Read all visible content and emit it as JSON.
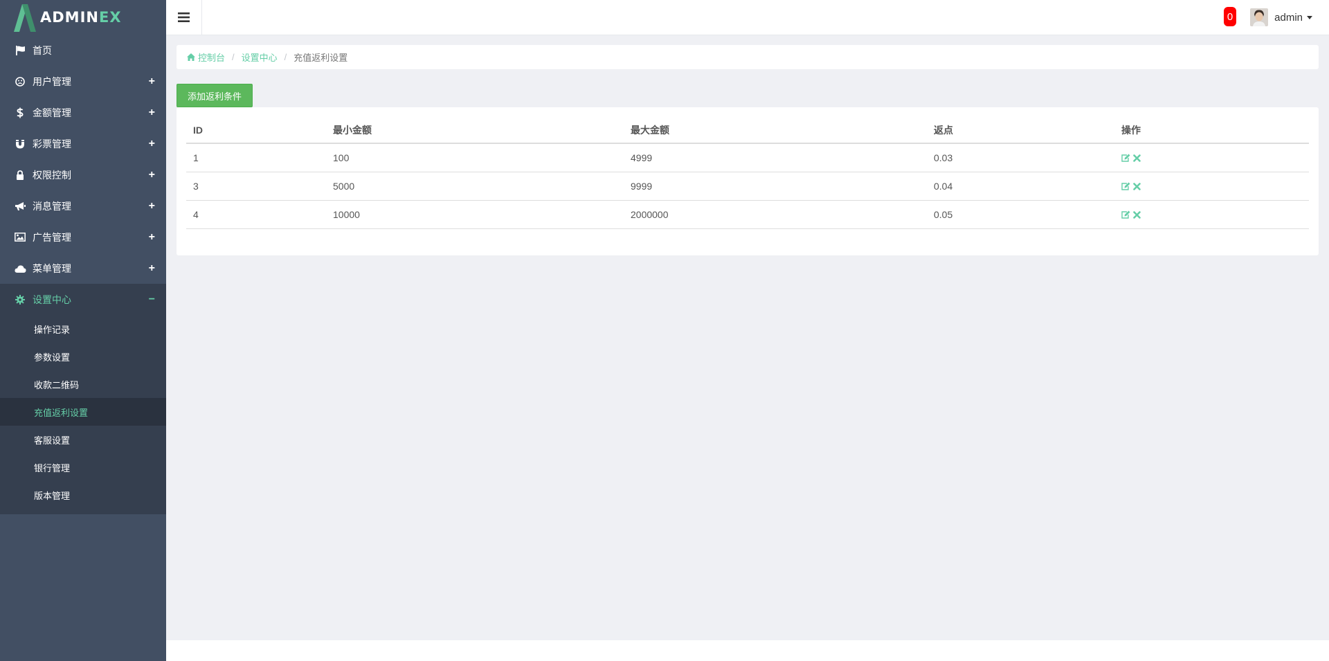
{
  "brand": {
    "name_main": "ADMIN",
    "name_accent": "EX"
  },
  "header": {
    "notification_count": "0",
    "user_name": "admin"
  },
  "sidebar": {
    "items": [
      {
        "label": "首页",
        "icon": "flag-icon"
      },
      {
        "label": "用户管理",
        "icon": "user-face-icon",
        "expand": "+"
      },
      {
        "label": "金额管理",
        "icon": "dollar-icon",
        "expand": "+"
      },
      {
        "label": "彩票管理",
        "icon": "magnet-icon",
        "expand": "+"
      },
      {
        "label": "权限控制",
        "icon": "lock-icon",
        "expand": "+"
      },
      {
        "label": "消息管理",
        "icon": "bullhorn-icon",
        "expand": "+"
      },
      {
        "label": "广告管理",
        "icon": "image-icon",
        "expand": "+"
      },
      {
        "label": "菜单管理",
        "icon": "cloud-icon",
        "expand": "+"
      },
      {
        "label": "设置中心",
        "icon": "gear-icon",
        "expand": "−"
      }
    ],
    "submenu": [
      "操作记录",
      "参数设置",
      "收款二维码",
      "充值返利设置",
      "客服设置",
      "银行管理",
      "版本管理"
    ]
  },
  "breadcrumb": {
    "home": "控制台",
    "section": "设置中心",
    "current": "充值返利设置"
  },
  "toolbar": {
    "add_label": "添加返利条件"
  },
  "table": {
    "columns": [
      "ID",
      "最小金额",
      "最大金额",
      "返点",
      "操作"
    ],
    "rows": [
      [
        "1",
        "100",
        "4999",
        "0.03"
      ],
      [
        "3",
        "5000",
        "9999",
        "0.04"
      ],
      [
        "4",
        "10000",
        "2000000",
        "0.05"
      ]
    ]
  },
  "colors": {
    "accent": "#65cea7",
    "sidebar": "#424f63",
    "add_button": "#5cb85c",
    "badge": "#ff0000"
  }
}
